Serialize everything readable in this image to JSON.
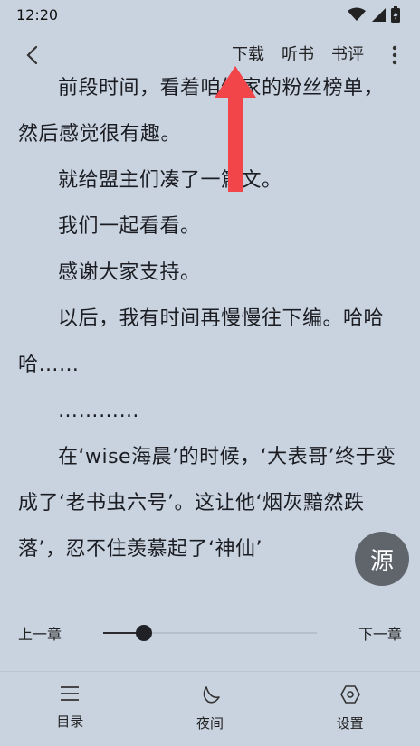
{
  "status": {
    "time": "12:20"
  },
  "topbar": {
    "download_label": "下载",
    "listen_label": "听书",
    "review_label": "书评"
  },
  "content": {
    "paragraphs": [
      "",
      "前段时间，看着咱们家的粉丝榜单，然后感觉很有趣。",
      "就给盟主们凑了一篇文。",
      "我们一起看看。",
      "感谢大家支持。",
      "以后，我有时间再慢慢往下编。哈哈哈……",
      "…………",
      "在‘wise海晨’的时候，‘大表哥’终于变成了‘老书虫六号’。这让他‘烟灰黯然跌落’，忍不住羡慕起了‘神仙’"
    ]
  },
  "chapter_nav": {
    "prev_label": "上一章",
    "next_label": "下一章",
    "progress_fraction": 0.19
  },
  "bottom_bar": {
    "toc_label": "目录",
    "night_label": "夜间",
    "settings_label": "设置"
  },
  "source_button": {
    "label": "源"
  },
  "colors": {
    "background": "#c9d3e0",
    "annotation_arrow": "#f2454a",
    "source_button": "#60646b"
  }
}
